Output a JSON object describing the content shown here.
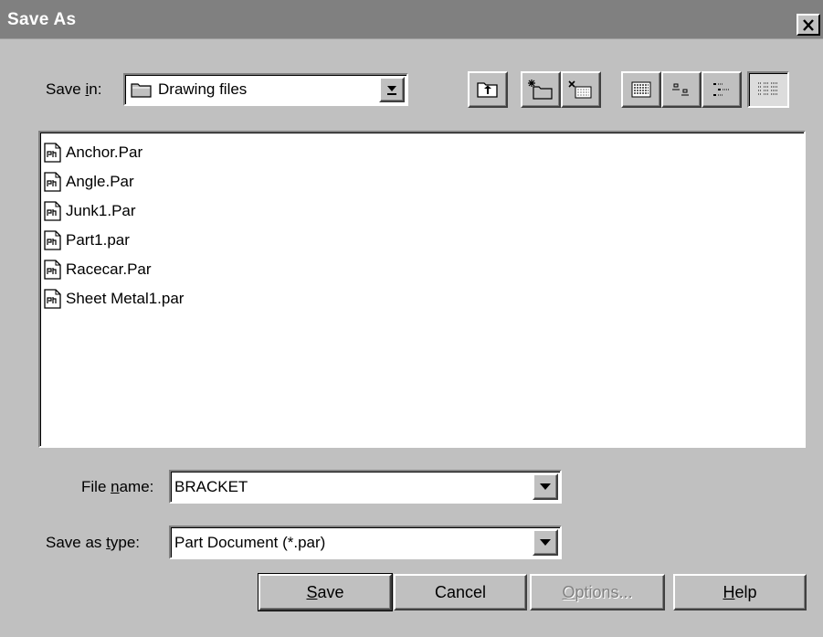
{
  "window": {
    "title": "Save As",
    "close_label": "×"
  },
  "save_in": {
    "label": "Save in:",
    "value": "Drawing files"
  },
  "toolbar": {
    "icons": [
      "up-one-level-icon",
      "create-new-folder-icon",
      "delete-icon",
      "list-view-icon",
      "small-icons-icon",
      "large-icons-icon",
      "details-view-icon"
    ]
  },
  "files": [
    {
      "name": "Anchor.Par"
    },
    {
      "name": "Angle.Par"
    },
    {
      "name": "Junk1.Par"
    },
    {
      "name": "Part1.par"
    },
    {
      "name": "Racecar.Par"
    },
    {
      "name": "Sheet Metal1.par"
    }
  ],
  "file_name": {
    "label": "File name:",
    "value": "BRACKET"
  },
  "save_as_type": {
    "label": "Save as type:",
    "value": "Part Document (*.par)"
  },
  "buttons": {
    "save": "Save",
    "cancel": "Cancel",
    "options": "Options...",
    "help": "Help"
  }
}
